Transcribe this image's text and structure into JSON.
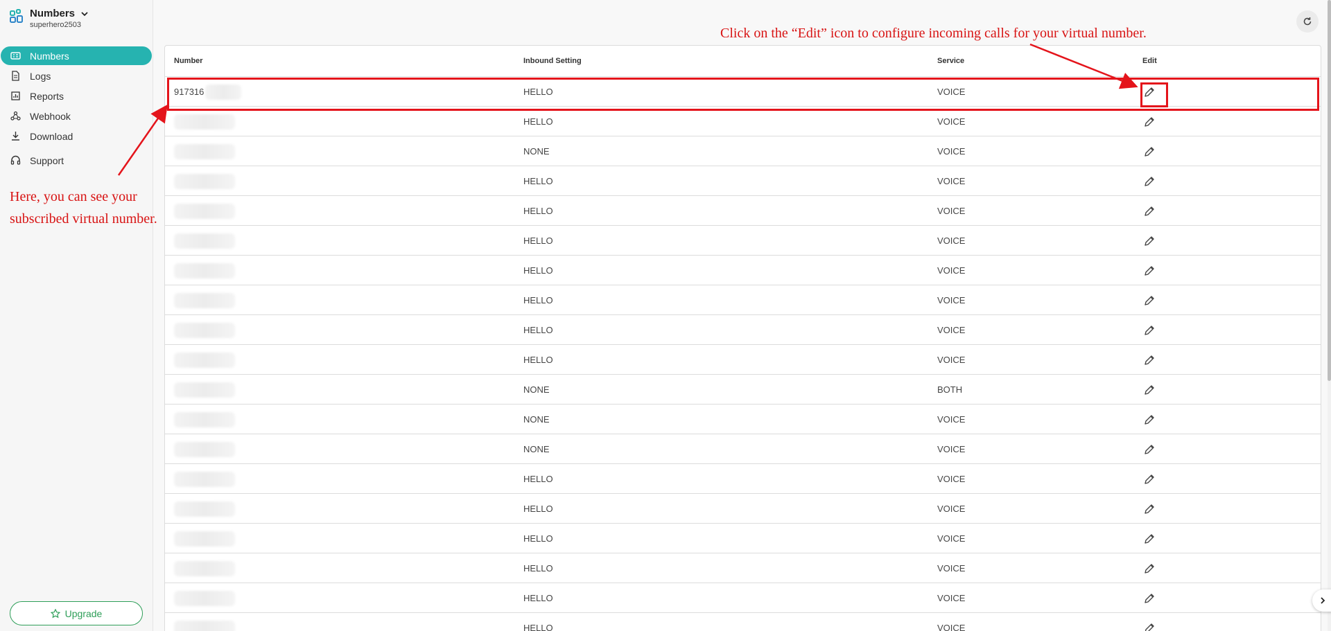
{
  "brand": {
    "title": "Numbers",
    "username": "superhero2503"
  },
  "sidebar": {
    "items": [
      {
        "label": "Numbers",
        "icon": "numbers-grid-icon",
        "active": true
      },
      {
        "label": "Logs",
        "icon": "document-icon"
      },
      {
        "label": "Reports",
        "icon": "report-icon"
      },
      {
        "label": "Webhook",
        "icon": "webhook-icon"
      },
      {
        "label": "Download",
        "icon": "download-icon"
      },
      {
        "label": "Support",
        "icon": "headset-icon"
      }
    ],
    "upgrade_label": "Upgrade"
  },
  "table": {
    "columns": [
      "Number",
      "Inbound Setting",
      "Service",
      "Edit"
    ],
    "rows": [
      {
        "number": "917316",
        "inbound": "HELLO",
        "service": "VOICE"
      },
      {
        "number": "",
        "inbound": "HELLO",
        "service": "VOICE"
      },
      {
        "number": "",
        "inbound": "NONE",
        "service": "VOICE"
      },
      {
        "number": "",
        "inbound": "HELLO",
        "service": "VOICE"
      },
      {
        "number": "",
        "inbound": "HELLO",
        "service": "VOICE"
      },
      {
        "number": "",
        "inbound": "HELLO",
        "service": "VOICE"
      },
      {
        "number": "",
        "inbound": "HELLO",
        "service": "VOICE"
      },
      {
        "number": "",
        "inbound": "HELLO",
        "service": "VOICE"
      },
      {
        "number": "",
        "inbound": "HELLO",
        "service": "VOICE"
      },
      {
        "number": "",
        "inbound": "HELLO",
        "service": "VOICE"
      },
      {
        "number": "",
        "inbound": "NONE",
        "service": "BOTH"
      },
      {
        "number": "",
        "inbound": "NONE",
        "service": "VOICE"
      },
      {
        "number": "",
        "inbound": "NONE",
        "service": "VOICE"
      },
      {
        "number": "",
        "inbound": "HELLO",
        "service": "VOICE"
      },
      {
        "number": "",
        "inbound": "HELLO",
        "service": "VOICE"
      },
      {
        "number": "",
        "inbound": "HELLO",
        "service": "VOICE"
      },
      {
        "number": "",
        "inbound": "HELLO",
        "service": "VOICE"
      },
      {
        "number": "",
        "inbound": "HELLO",
        "service": "VOICE"
      },
      {
        "number": "",
        "inbound": "HELLO",
        "service": "VOICE"
      }
    ]
  },
  "annotations": {
    "edit_hint": "Click on the “Edit” icon to configure incoming calls for your virtual number.",
    "number_hint": "Here, you can see your subscribed virtual number."
  },
  "colors": {
    "accent": "#26b3b0",
    "annotation": "#e4141b",
    "upgrade": "#2e9e58"
  }
}
